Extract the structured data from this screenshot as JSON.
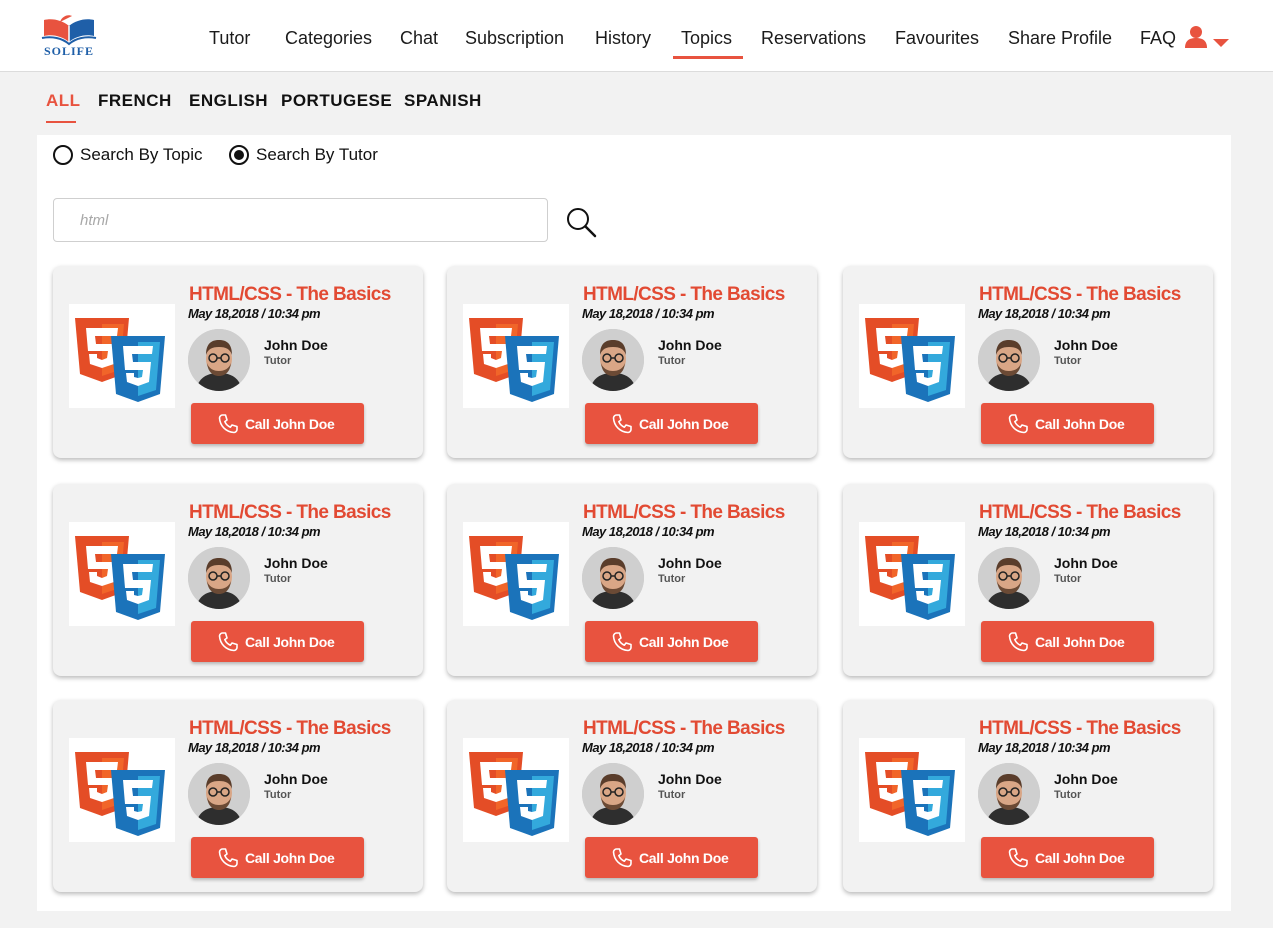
{
  "app": {
    "logo_text": "SOLIFE"
  },
  "nav": {
    "items": [
      {
        "label": "Tutor",
        "active": false
      },
      {
        "label": "Categories",
        "active": false
      },
      {
        "label": "Chat",
        "active": false
      },
      {
        "label": "Subscription",
        "active": false
      },
      {
        "label": "History",
        "active": false
      },
      {
        "label": "Topics",
        "active": true
      },
      {
        "label": "Reservations",
        "active": false
      },
      {
        "label": "Favourites",
        "active": false
      },
      {
        "label": "Share Profile",
        "active": false
      },
      {
        "label": "FAQ",
        "active": false
      }
    ],
    "user_icon": "user-icon",
    "dropdown_icon": "caret-down-icon"
  },
  "language_tabs": [
    {
      "label": "ALL",
      "active": true
    },
    {
      "label": "FRENCH",
      "active": false
    },
    {
      "label": "ENGLISH",
      "active": false
    },
    {
      "label": "PORTUGESE",
      "active": false
    },
    {
      "label": "SPANISH",
      "active": false
    }
  ],
  "search": {
    "mode_options": [
      {
        "label": "Search By Topic",
        "checked": false
      },
      {
        "label": "Search By Tutor",
        "checked": true
      }
    ],
    "placeholder": "html",
    "value": "",
    "icon": "search-icon"
  },
  "cards": [
    {
      "title": "HTML/CSS - The Basics",
      "date": "May 18,2018 / 10:34 pm",
      "tutor_name": "John Doe",
      "tutor_role": "Tutor",
      "button_label": "Call John Doe"
    },
    {
      "title": "HTML/CSS - The Basics",
      "date": "May 18,2018 / 10:34 pm",
      "tutor_name": "John Doe",
      "tutor_role": "Tutor",
      "button_label": "Call John Doe"
    },
    {
      "title": "HTML/CSS - The Basics",
      "date": "May 18,2018 / 10:34 pm",
      "tutor_name": "John Doe",
      "tutor_role": "Tutor",
      "button_label": "Call John Doe"
    },
    {
      "title": "HTML/CSS - The Basics",
      "date": "May 18,2018 / 10:34 pm",
      "tutor_name": "John Doe",
      "tutor_role": "Tutor",
      "button_label": "Call John Doe"
    },
    {
      "title": "HTML/CSS - The Basics",
      "date": "May 18,2018 / 10:34 pm",
      "tutor_name": "John Doe",
      "tutor_role": "Tutor",
      "button_label": "Call John Doe"
    },
    {
      "title": "HTML/CSS - The Basics",
      "date": "May 18,2018 / 10:34 pm",
      "tutor_name": "John Doe",
      "tutor_role": "Tutor",
      "button_label": "Call John Doe"
    },
    {
      "title": "HTML/CSS - The Basics",
      "date": "May 18,2018 / 10:34 pm",
      "tutor_name": "John Doe",
      "tutor_role": "Tutor",
      "button_label": "Call John Doe"
    },
    {
      "title": "HTML/CSS - The Basics",
      "date": "May 18,2018 / 10:34 pm",
      "tutor_name": "John Doe",
      "tutor_role": "Tutor",
      "button_label": "Call John Doe"
    },
    {
      "title": "HTML/CSS - The Basics",
      "date": "May 18,2018 / 10:34 pm",
      "tutor_name": "John Doe",
      "tutor_role": "Tutor",
      "button_label": "Call John Doe"
    }
  ],
  "colors": {
    "accent": "#e8533f",
    "title": "#e24a33",
    "html5": "#e44d26",
    "css3": "#1b73ba",
    "logo_blue": "#1f5fa8"
  }
}
